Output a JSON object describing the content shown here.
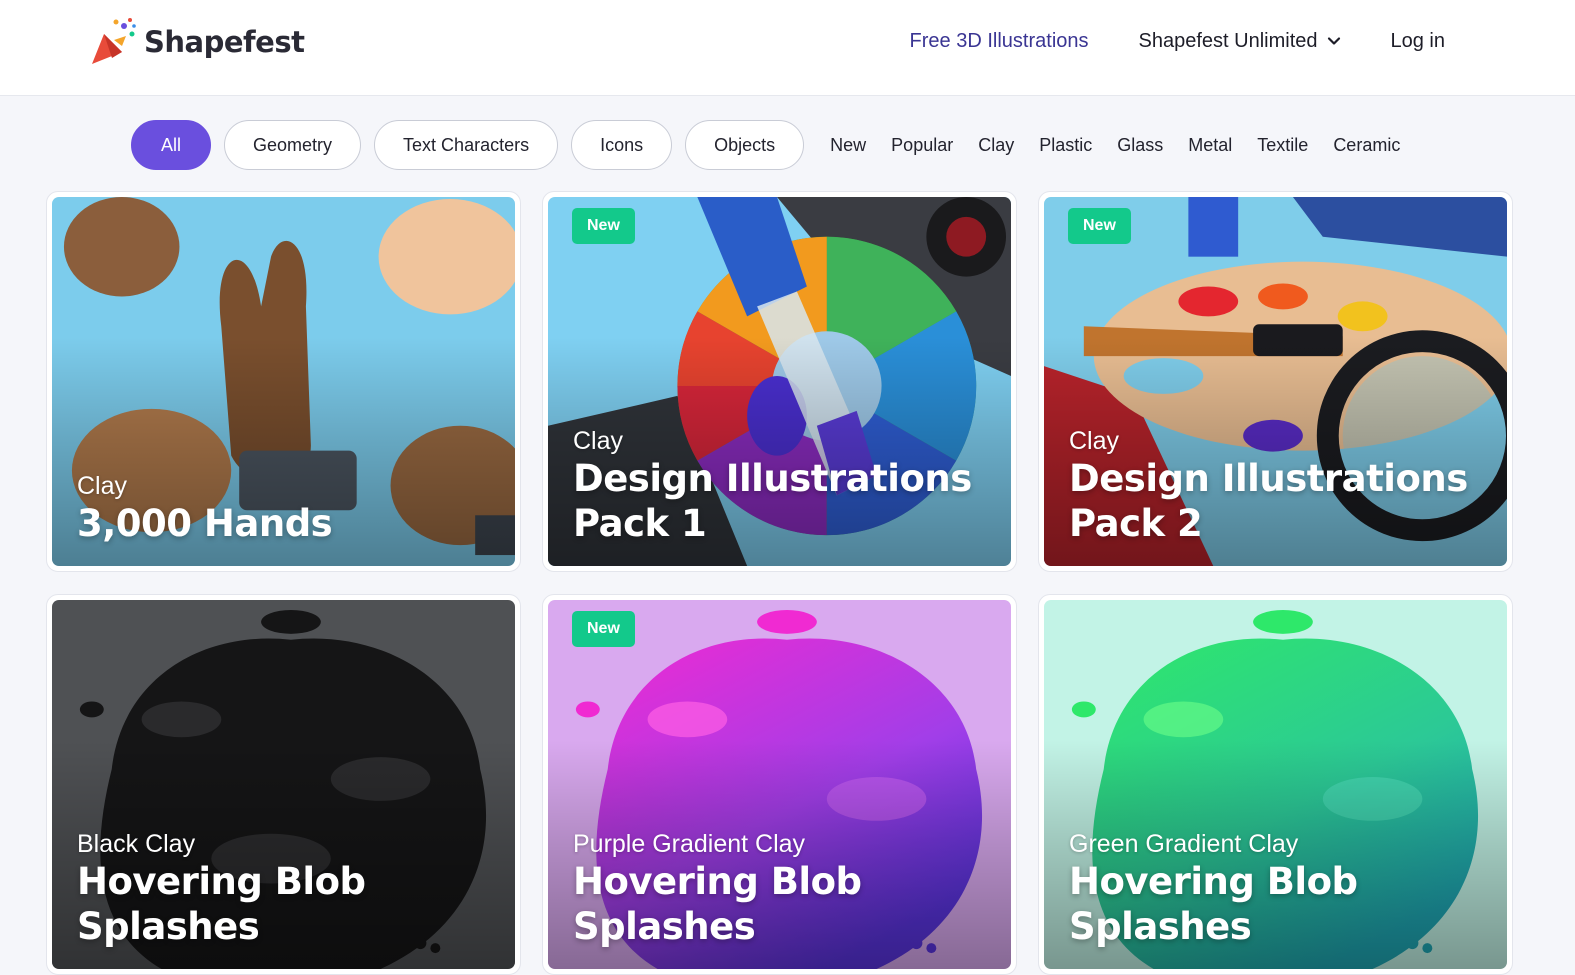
{
  "brand": {
    "name": "Shapefest",
    "logo_icon": "party-cone-logo",
    "colors": {
      "accent": "#6a4fde",
      "badge": "#13c98b",
      "nav_accent": "#3a3593"
    }
  },
  "nav": {
    "free_illustrations": "Free 3D Illustrations",
    "unlimited": "Shapefest Unlimited",
    "login": "Log in"
  },
  "filters": {
    "pills": [
      {
        "label": "All",
        "active": true
      },
      {
        "label": "Geometry",
        "active": false
      },
      {
        "label": "Text Characters",
        "active": false
      },
      {
        "label": "Icons",
        "active": false
      },
      {
        "label": "Objects",
        "active": false
      }
    ],
    "tags": [
      "New",
      "Popular",
      "Clay",
      "Plastic",
      "Glass",
      "Metal",
      "Textile",
      "Ceramic"
    ]
  },
  "cards": [
    {
      "badge": "",
      "subtitle": "Clay",
      "title": "3,000 Hands",
      "art": "clay-hands"
    },
    {
      "badge": "New",
      "subtitle": "Clay",
      "title": "Design Illustrations Pack 1",
      "art": "color-wheel-dropper"
    },
    {
      "badge": "New",
      "subtitle": "Clay",
      "title": "Design Illustrations Pack 2",
      "art": "paint-palette-magnifier"
    },
    {
      "badge": "",
      "subtitle": "Black Clay",
      "title": "Hovering Blob Splashes",
      "art": "black-blob-splash"
    },
    {
      "badge": "New",
      "subtitle": "Purple Gradient Clay",
      "title": "Hovering Blob Splashes",
      "art": "purple-blob-splash"
    },
    {
      "badge": "",
      "subtitle": "Green Gradient Clay",
      "title": "Hovering Blob Splashes",
      "art": "green-blob-splash"
    }
  ]
}
